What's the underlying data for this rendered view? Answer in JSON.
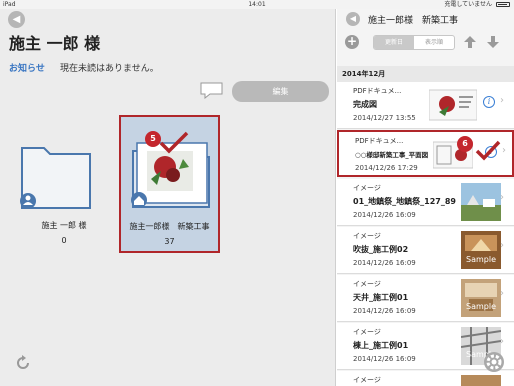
{
  "status_bar": {
    "device": "iPad",
    "time": "14:01",
    "battery": "充電していません"
  },
  "left": {
    "owner_title": "施主 一郎 様",
    "notice_label": "お知らせ",
    "notice_text": "現在未読はありません。",
    "edit_button": "編集",
    "folders": [
      {
        "name": "施主 一郎 様",
        "count": "0",
        "icon": "person-icon"
      },
      {
        "name": "施主一郎様　新築工事",
        "count": "37",
        "icon": "home-icon"
      }
    ],
    "step_badge": "5"
  },
  "right": {
    "title": "施主一郎様　新築工事",
    "sort_tabs": [
      "更新日",
      "表示順"
    ],
    "section": "2014年12月",
    "step_badge": "6",
    "items": [
      {
        "type": "PDFドキュメ...",
        "name": "完成図",
        "date": "2014/12/27 13:55",
        "thumb": "pdf"
      },
      {
        "type": "PDFドキュメ...",
        "name": "○○様邸新築工事_平面図",
        "date": "2014/12/26 17:29",
        "thumb": "pdf"
      },
      {
        "type": "イメージ",
        "name": "01_地鎮祭_地鎮祭_127_89",
        "date": "2014/12/26 16:09",
        "thumb": "photo-outdoor"
      },
      {
        "type": "イメージ",
        "name": "吹抜_施工例02",
        "date": "2014/12/26 16:09",
        "thumb": "sample"
      },
      {
        "type": "イメージ",
        "name": "天井_施工例01",
        "date": "2014/12/26 16:09",
        "thumb": "sample"
      },
      {
        "type": "イメージ",
        "name": "棟上_施工例01",
        "date": "2014/12/26 16:09",
        "thumb": "sample"
      },
      {
        "type": "イメージ",
        "name": "",
        "date": "",
        "thumb": "photo"
      }
    ]
  },
  "colors": {
    "highlight": "#b0262a",
    "accent": "#3a7fd5",
    "folder": "#4a77ad"
  }
}
